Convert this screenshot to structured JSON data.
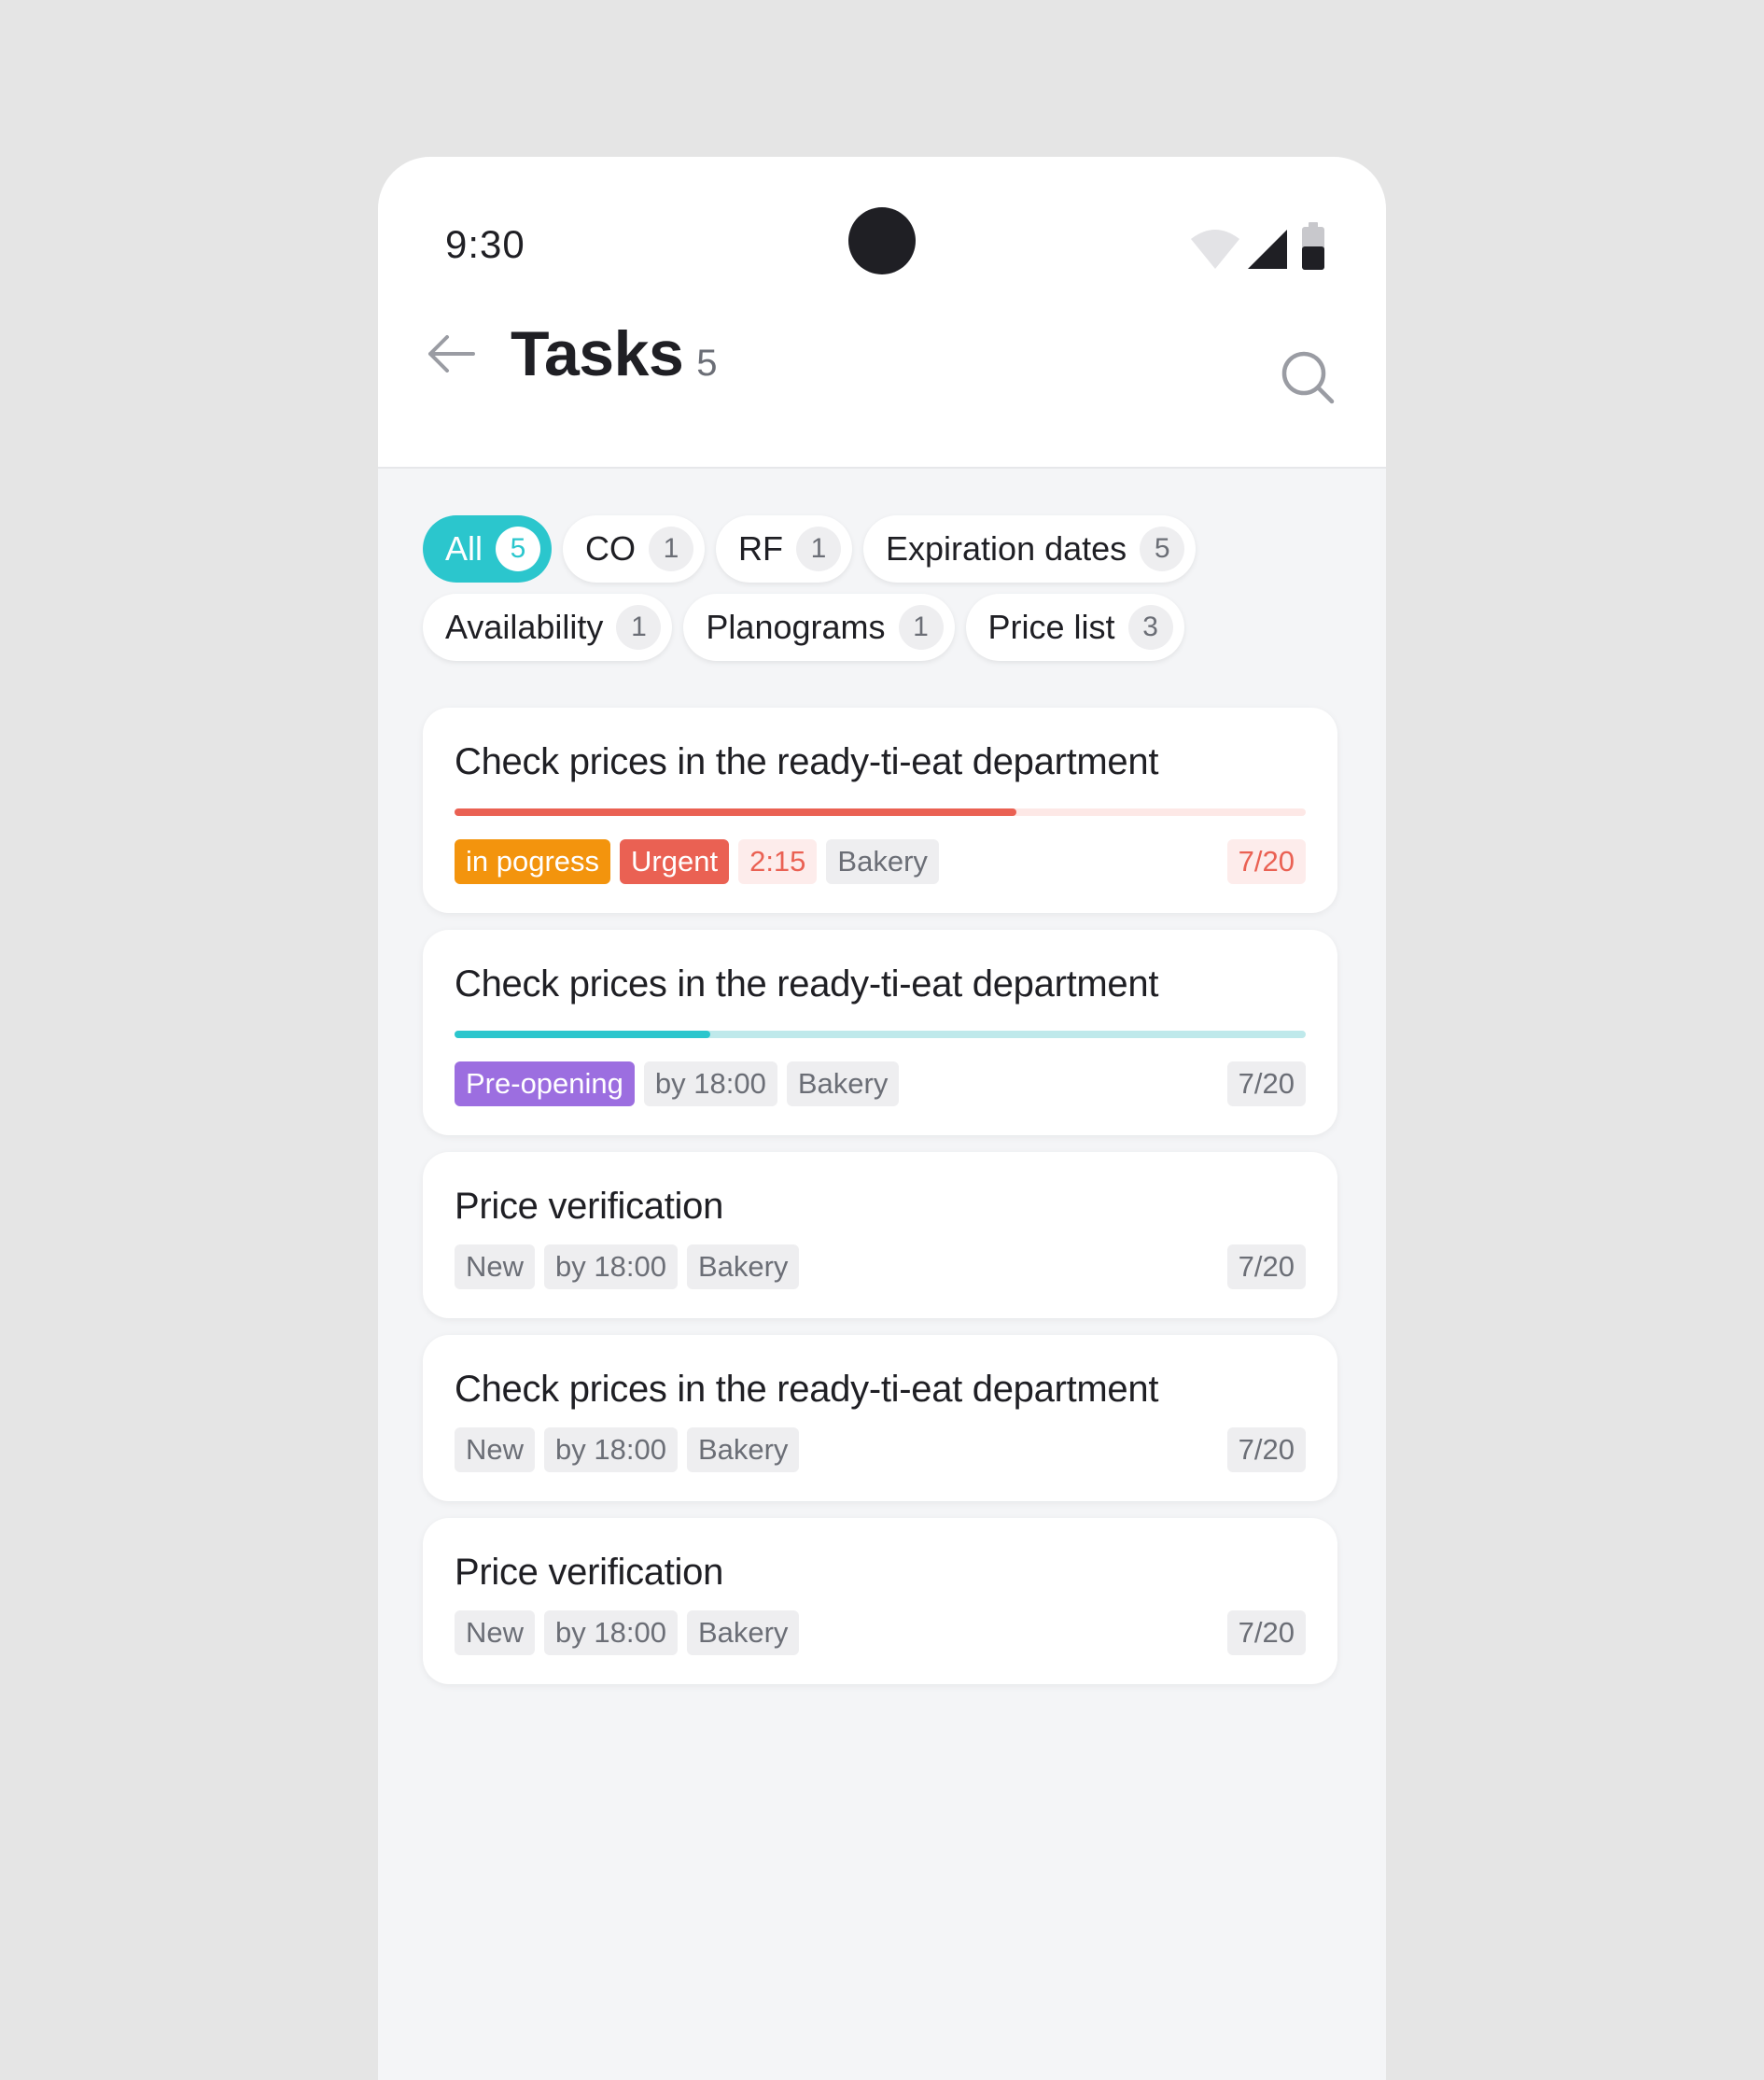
{
  "status_bar": {
    "time": "9:30"
  },
  "header": {
    "title": "Tasks",
    "count": "5"
  },
  "filters": [
    {
      "label": "All",
      "count": "5",
      "active": true
    },
    {
      "label": "CO",
      "count": "1"
    },
    {
      "label": "RF",
      "count": "1"
    },
    {
      "label": "Expiration dates",
      "count": "5"
    },
    {
      "label": "Availability",
      "count": "1"
    },
    {
      "label": "Planograms",
      "count": "1"
    },
    {
      "label": "Price list",
      "count": "3"
    }
  ],
  "colors": {
    "accent": "#2bc6cd",
    "urgent": "#ea6153",
    "in_progress": "#f3940d",
    "pre_opening": "#9c6ee0",
    "neutral_tag_bg": "#eeeef0"
  },
  "tasks": [
    {
      "title": "Check prices in the ready-ti-eat department",
      "progress": {
        "value": 0.66,
        "color": "#ea6153",
        "track": "#fde8e6"
      },
      "tags": [
        {
          "text": "in pogress",
          "bg": "#f3940d",
          "fg": "#ffffff"
        },
        {
          "text": "Urgent",
          "bg": "#ea6153",
          "fg": "#ffffff"
        },
        {
          "text": "2:15",
          "bg": "#fdeceb",
          "fg": "#ea6153"
        },
        {
          "text": "Bakery",
          "bg": "#eeeef0",
          "fg": "#6b6e76"
        }
      ],
      "counter": {
        "text": "7/20",
        "bg": "#fdeceb",
        "fg": "#ea6153"
      }
    },
    {
      "title": "Check prices in the ready-ti-eat department",
      "progress": {
        "value": 0.3,
        "color": "#2bc6cd",
        "track": "#bfe9eb"
      },
      "tags": [
        {
          "text": "Pre-opening",
          "bg": "#9c6ee0",
          "fg": "#ffffff"
        },
        {
          "text": "by 18:00",
          "bg": "#eeeef0",
          "fg": "#6b6e76"
        },
        {
          "text": "Bakery",
          "bg": "#eeeef0",
          "fg": "#6b6e76"
        }
      ],
      "counter": {
        "text": "7/20",
        "bg": "#eeeef0",
        "fg": "#6b6e76"
      }
    },
    {
      "title": "Price verification",
      "tags": [
        {
          "text": "New",
          "bg": "#eeeef0",
          "fg": "#6b6e76"
        },
        {
          "text": "by 18:00",
          "bg": "#eeeef0",
          "fg": "#6b6e76"
        },
        {
          "text": "Bakery",
          "bg": "#eeeef0",
          "fg": "#6b6e76"
        }
      ],
      "counter": {
        "text": "7/20",
        "bg": "#eeeef0",
        "fg": "#6b6e76"
      }
    },
    {
      "title": "Check prices in the ready-ti-eat department",
      "tags": [
        {
          "text": "New",
          "bg": "#eeeef0",
          "fg": "#6b6e76"
        },
        {
          "text": "by 18:00",
          "bg": "#eeeef0",
          "fg": "#6b6e76"
        },
        {
          "text": "Bakery",
          "bg": "#eeeef0",
          "fg": "#6b6e76"
        }
      ],
      "counter": {
        "text": "7/20",
        "bg": "#eeeef0",
        "fg": "#6b6e76"
      }
    },
    {
      "title": "Price verification",
      "tags": [
        {
          "text": "New",
          "bg": "#eeeef0",
          "fg": "#6b6e76"
        },
        {
          "text": "by 18:00",
          "bg": "#eeeef0",
          "fg": "#6b6e76"
        },
        {
          "text": "Bakery",
          "bg": "#eeeef0",
          "fg": "#6b6e76"
        }
      ],
      "counter": {
        "text": "7/20",
        "bg": "#eeeef0",
        "fg": "#6b6e76"
      }
    }
  ],
  "icons": [
    "wifi-icon",
    "signal-icon",
    "battery-icon",
    "back-arrow-icon",
    "search-icon"
  ]
}
